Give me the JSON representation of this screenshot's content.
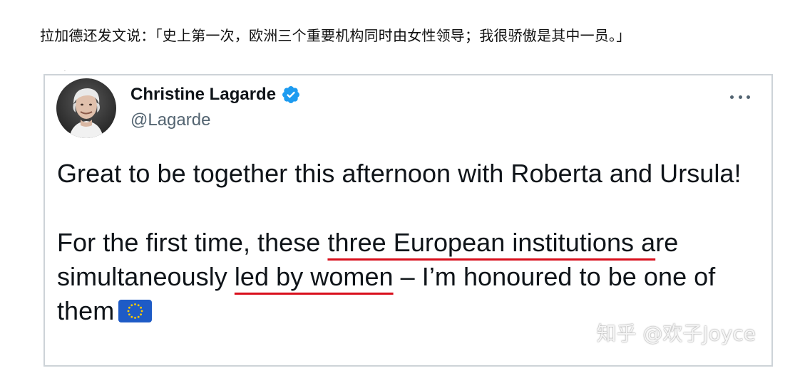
{
  "caption": "拉加德还发文说：「史上第一次，欧洲三个重要机构同时由女性领导；我很骄傲是其中一员。」",
  "tweet": {
    "author_name": "Christine Lagarde",
    "handle": "@Lagarde",
    "verified": true,
    "verified_icon": "verified-badge",
    "more_icon": "more-horizontal-icon",
    "line1": "Great to be together this afternoon with Roberta and Ursula!",
    "p2_part1": "For the first time, these ",
    "p2_highlight1": "three European institutions a",
    "p2_part2": "re simultaneously ",
    "p2_highlight2": "led by women",
    "p2_part3": " – I’m honoured to be one of them",
    "flag_icon": "eu-flag"
  },
  "watermark": "知乎 @欢子Joyce",
  "colors": {
    "verified_blue": "#1d9bf0",
    "underline_red": "#d90f1c",
    "eu_blue": "#003399",
    "eu_gold": "#ffcc00"
  }
}
